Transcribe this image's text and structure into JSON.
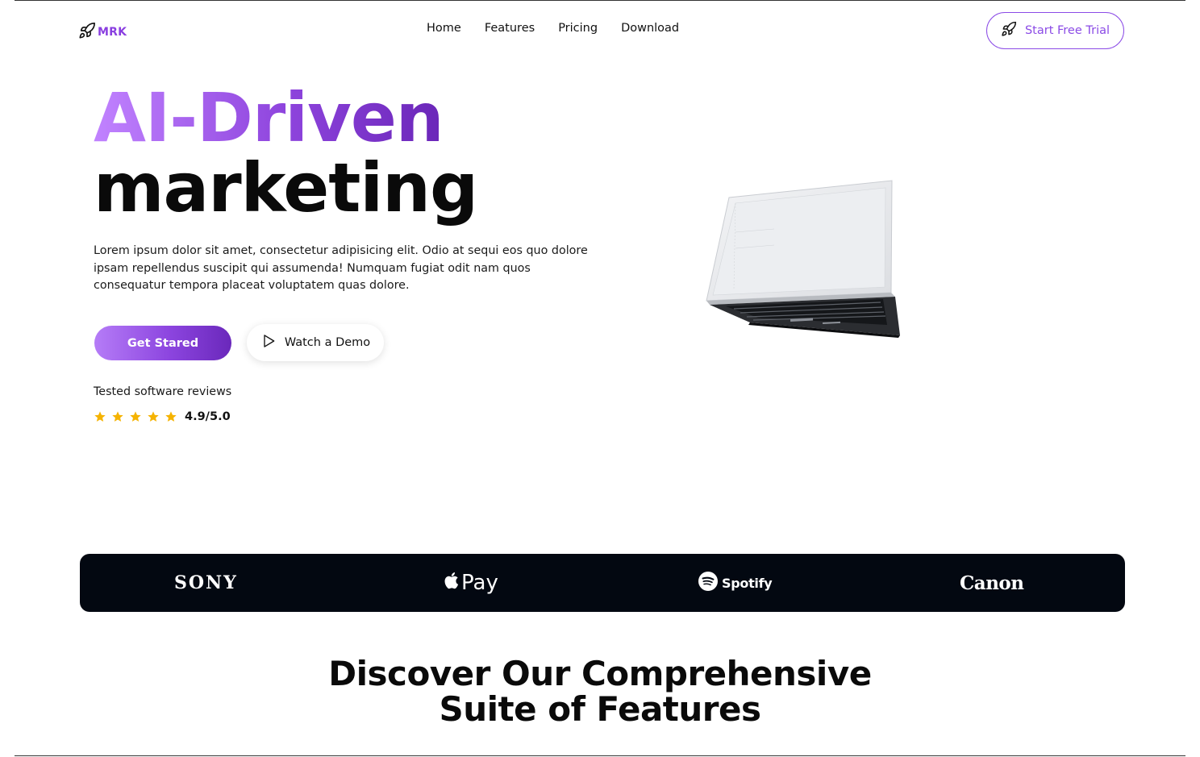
{
  "nav": {
    "logo_text": "MRK",
    "links": [
      {
        "label": "Home"
      },
      {
        "label": "Features"
      },
      {
        "label": "Pricing"
      },
      {
        "label": "Download"
      }
    ],
    "cta_label": "Start Free Trial"
  },
  "hero": {
    "title_line1": "AI-Driven",
    "title_line2": "marketing",
    "description": "Lorem ipsum dolor sit amet, consectetur adipisicing elit. Odio at sequi eos quo dolore ipsam repellendus suscipit qui assumenda! Numquam fugiat odit nam quos consequatur tempora placeat voluptatem quas dolore.",
    "primary_button": "Get Stared",
    "secondary_button": "Watch a Demo",
    "reviews_label": "Tested software reviews",
    "rating": "4.9/5.0",
    "stars": 5
  },
  "brands": {
    "sony": "SONY",
    "apple_pay": "Pay",
    "spotify": "Spotify",
    "canon": "Canon"
  },
  "features": {
    "title_line1": "Discover Our Comprehensive",
    "title_line2": "Suite of Features"
  },
  "colors": {
    "accent": "#8b4be6",
    "gradient_start": "#c183ff",
    "gradient_end": "#6a26b8",
    "brand_bar": "#030811",
    "star": "#f5b301"
  },
  "icons": {
    "logo": "rocket-icon",
    "cta": "rocket-icon",
    "demo": "play-icon",
    "rating": "star-icon",
    "apple": "apple-icon",
    "spotify": "spotify-icon"
  }
}
